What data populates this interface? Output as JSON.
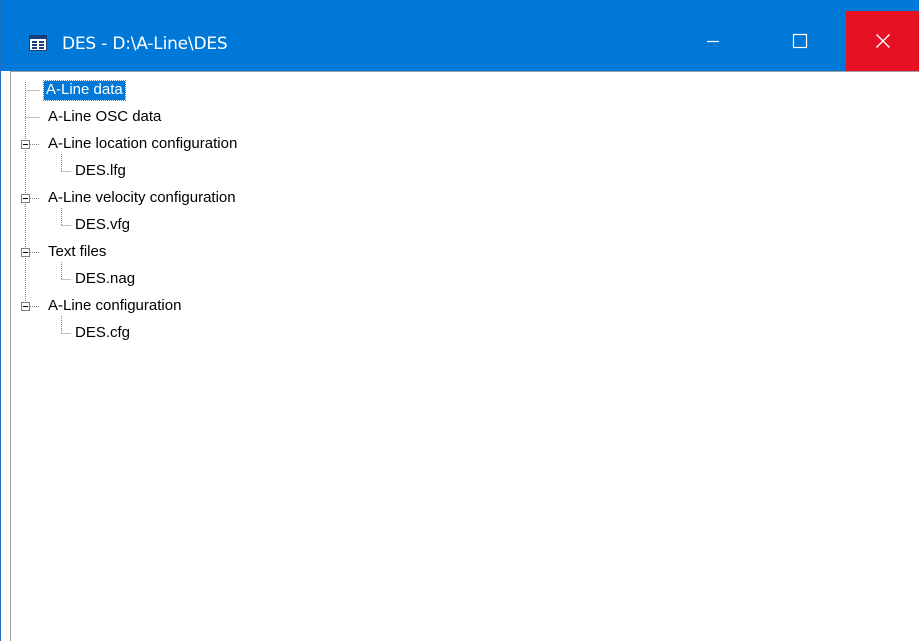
{
  "window": {
    "title": "DES - D:\\A-Line\\DES",
    "colors": {
      "titlebar": "#0078d7",
      "close_button": "#e81123",
      "selection": "#0078d7"
    }
  },
  "tree": {
    "items": [
      {
        "label": "A-Line data",
        "level": 0,
        "selected": true,
        "expanded": null
      },
      {
        "label": "A-Line OSC data",
        "level": 0,
        "selected": false,
        "expanded": null
      },
      {
        "label": "A-Line location configuration",
        "level": 0,
        "selected": false,
        "expanded": true
      },
      {
        "label": "DES.lfg",
        "level": 1,
        "selected": false,
        "expanded": null
      },
      {
        "label": "A-Line velocity configuration",
        "level": 0,
        "selected": false,
        "expanded": true
      },
      {
        "label": "DES.vfg",
        "level": 1,
        "selected": false,
        "expanded": null
      },
      {
        "label": "Text files",
        "level": 0,
        "selected": false,
        "expanded": true
      },
      {
        "label": "DES.nag",
        "level": 1,
        "selected": false,
        "expanded": null
      },
      {
        "label": "A-Line configuration",
        "level": 0,
        "selected": false,
        "expanded": true
      },
      {
        "label": "DES.cfg",
        "level": 1,
        "selected": false,
        "expanded": null
      }
    ]
  }
}
